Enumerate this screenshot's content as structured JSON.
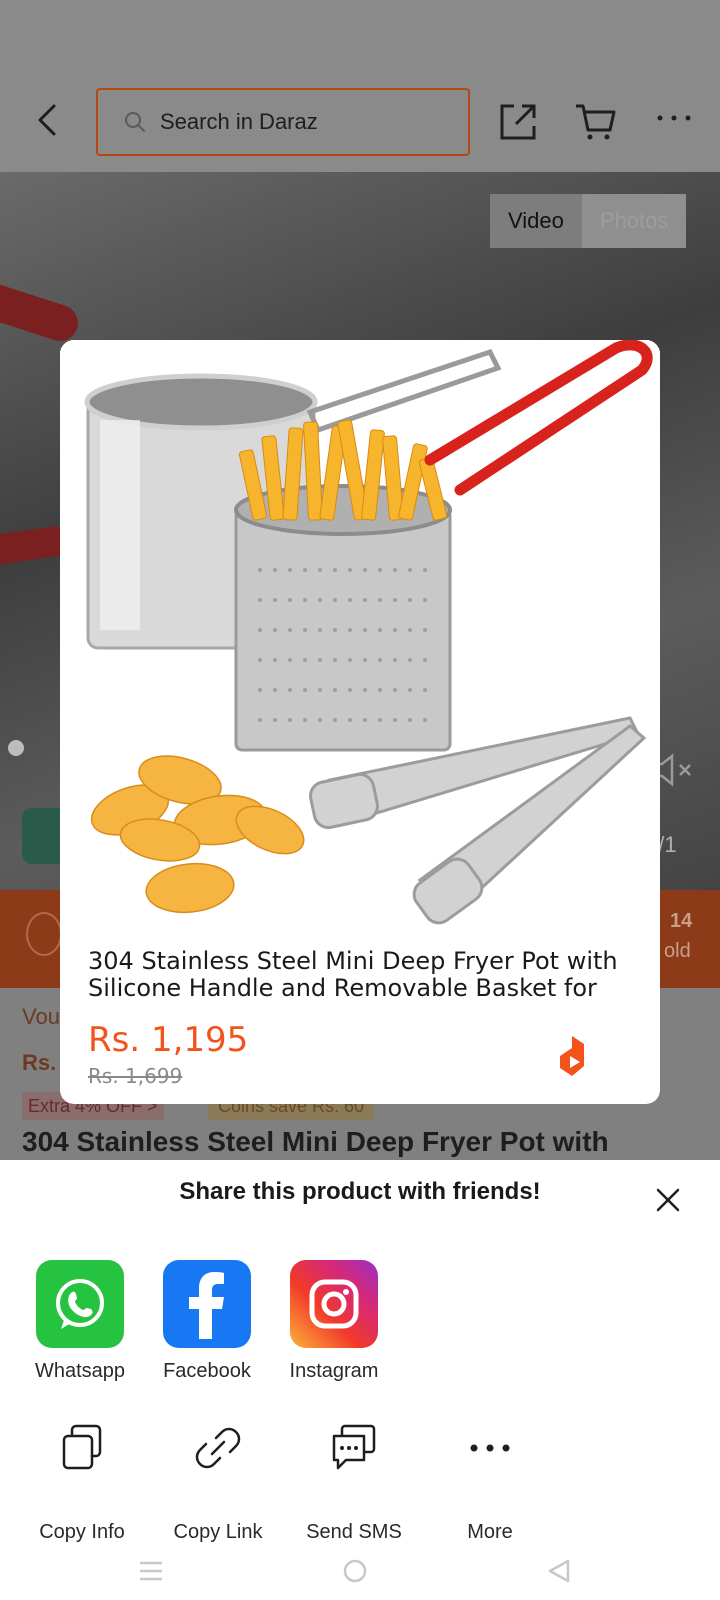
{
  "header": {
    "search_placeholder": "Search in Daraz"
  },
  "media": {
    "tabs": [
      {
        "label": "Video",
        "active": true
      },
      {
        "label": "Photos",
        "active": false
      }
    ],
    "counter": "1/1"
  },
  "promo": {
    "sold_count": "14",
    "sold_label": "old"
  },
  "product_peek": {
    "voucher_text": "Vou",
    "price_prefix": "Rs.",
    "extra_off": "Extra 4% OFF >",
    "coins": "Coins save Rs. 60",
    "title": "304 Stainless Steel Mini Deep Fryer Pot with"
  },
  "card": {
    "title": "304 Stainless Steel Mini Deep Fryer Pot with Silicone Handle and Removable Basket for",
    "price": "Rs. 1,195",
    "old_price": "Rs. 1,699"
  },
  "share": {
    "title": "Share this product with friends!",
    "apps": [
      {
        "label": "Whatsapp",
        "icon": "whatsapp-icon",
        "color": "#25c33f"
      },
      {
        "label": "Facebook",
        "icon": "facebook-icon",
        "color": "#1877f2"
      },
      {
        "label": "Instagram",
        "icon": "instagram-icon",
        "color": "#e1306c"
      }
    ],
    "actions": [
      {
        "label": "Copy Info",
        "icon": "copy-info-icon"
      },
      {
        "label": "Copy Link",
        "icon": "link-icon"
      },
      {
        "label": "Send SMS",
        "icon": "sms-icon"
      },
      {
        "label": "More",
        "icon": "more-dots-icon"
      }
    ]
  },
  "colors": {
    "accent": "#f3521b",
    "search_border": "#b14a14"
  }
}
